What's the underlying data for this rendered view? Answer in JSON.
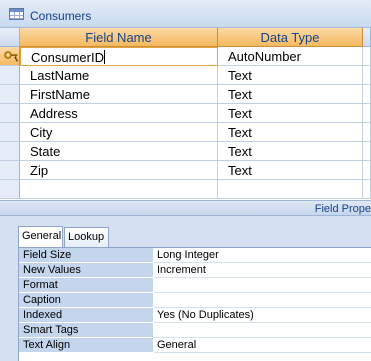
{
  "window": {
    "title": "Consumers",
    "icon": "table-icon"
  },
  "grid": {
    "headers": {
      "field_name": "Field Name",
      "data_type": "Data Type"
    },
    "rows": [
      {
        "name": "ConsumerID",
        "type": "AutoNumber",
        "primary_key": true
      },
      {
        "name": "LastName",
        "type": "Text"
      },
      {
        "name": "FirstName",
        "type": "Text"
      },
      {
        "name": "Address",
        "type": "Text"
      },
      {
        "name": "City",
        "type": "Text"
      },
      {
        "name": "State",
        "type": "Text"
      },
      {
        "name": "Zip",
        "type": "Text"
      },
      {
        "name": "",
        "type": ""
      }
    ],
    "primary_key_icon": "key-icon"
  },
  "field_properties": {
    "label": "Field Prope",
    "tabs": [
      "General",
      "Lookup"
    ],
    "active_tab": "General",
    "rows": [
      {
        "label": "Field Size",
        "value": "Long Integer"
      },
      {
        "label": "New Values",
        "value": "Increment"
      },
      {
        "label": "Format",
        "value": ""
      },
      {
        "label": "Caption",
        "value": ""
      },
      {
        "label": "Indexed",
        "value": "Yes (No Duplicates)"
      },
      {
        "label": "Smart Tags",
        "value": ""
      },
      {
        "label": "Text Align",
        "value": "General"
      }
    ]
  },
  "colors": {
    "header_orange": "#f5b95f",
    "title_blue": "#15428b",
    "property_label_bg": "#c3d6ee"
  }
}
